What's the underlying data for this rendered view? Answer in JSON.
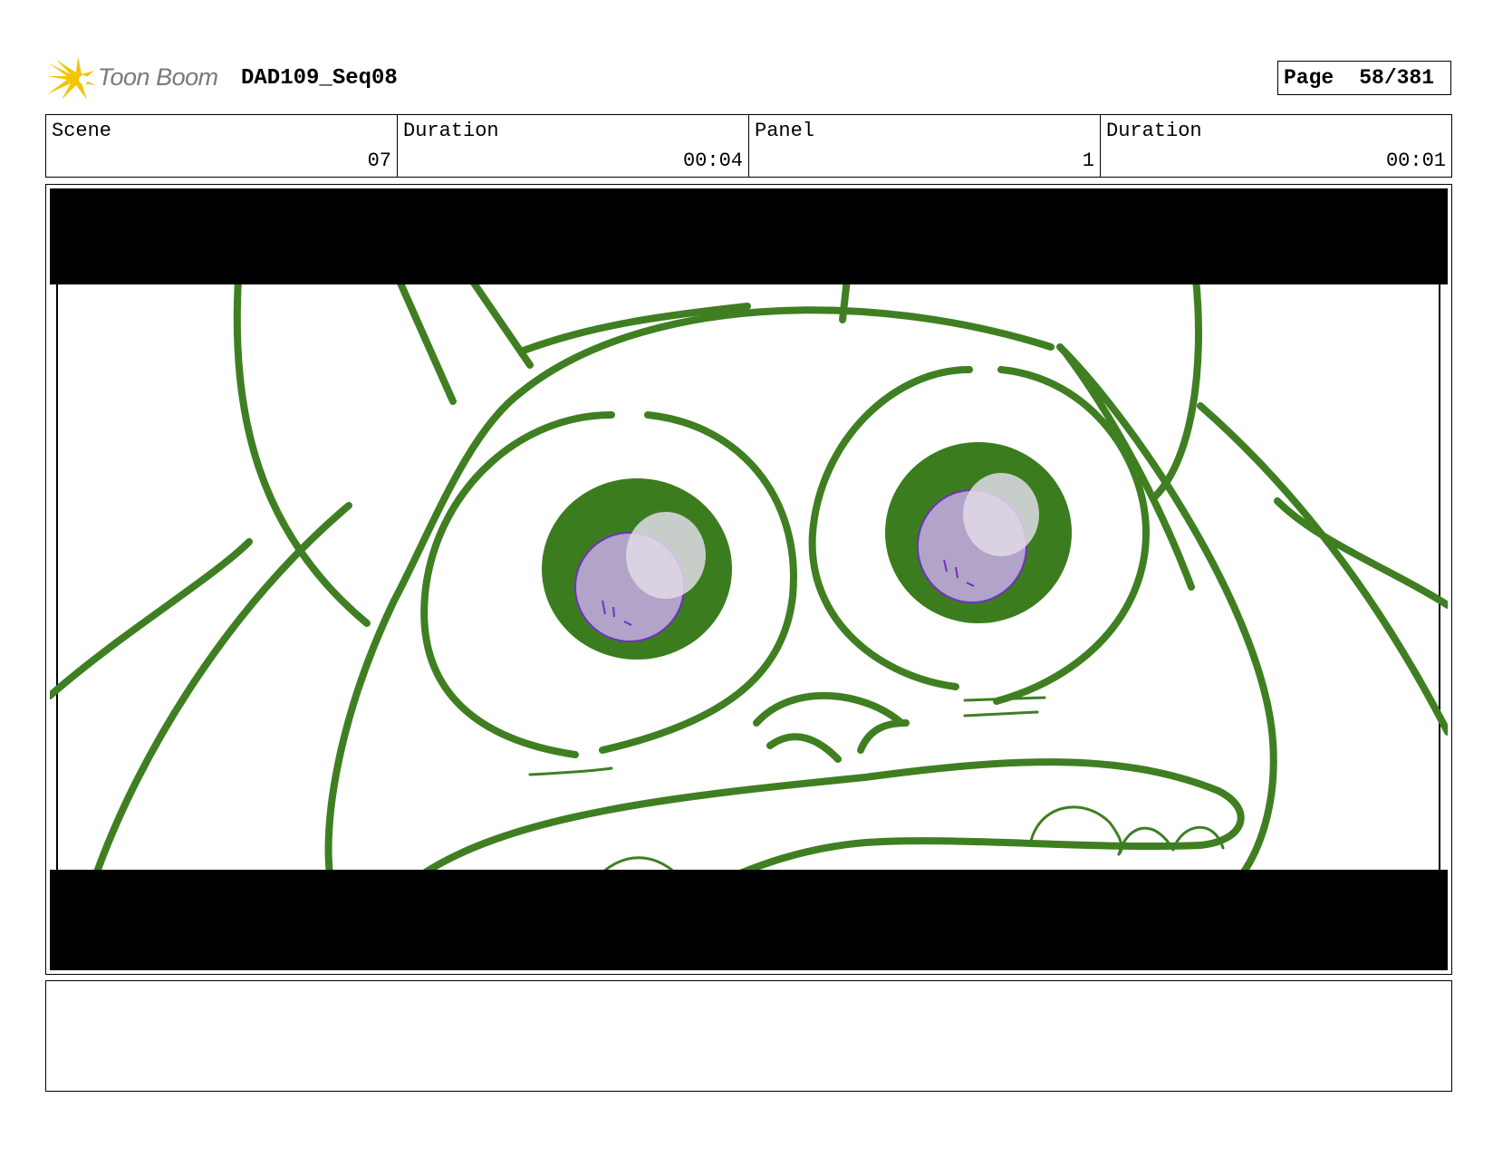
{
  "header": {
    "logo_text": "Toon Boom",
    "sequence_title": "DAD109_Seq08",
    "page_label": "Page",
    "page_number": "58/381"
  },
  "info": [
    {
      "label": "Scene",
      "value": "07"
    },
    {
      "label": "Duration",
      "value": "00:04"
    },
    {
      "label": "Panel",
      "value": "1"
    },
    {
      "label": "Duration",
      "value": "00:01"
    }
  ],
  "colors": {
    "line_green": "#3f7f22",
    "iris_green": "#3b7d1e",
    "pupil_purple": "#b2a3c8",
    "pupil_outline": "#7030c0",
    "letterbox": "#000000",
    "logo_yellow": "#f5c400"
  },
  "notes": {
    "text": ""
  }
}
